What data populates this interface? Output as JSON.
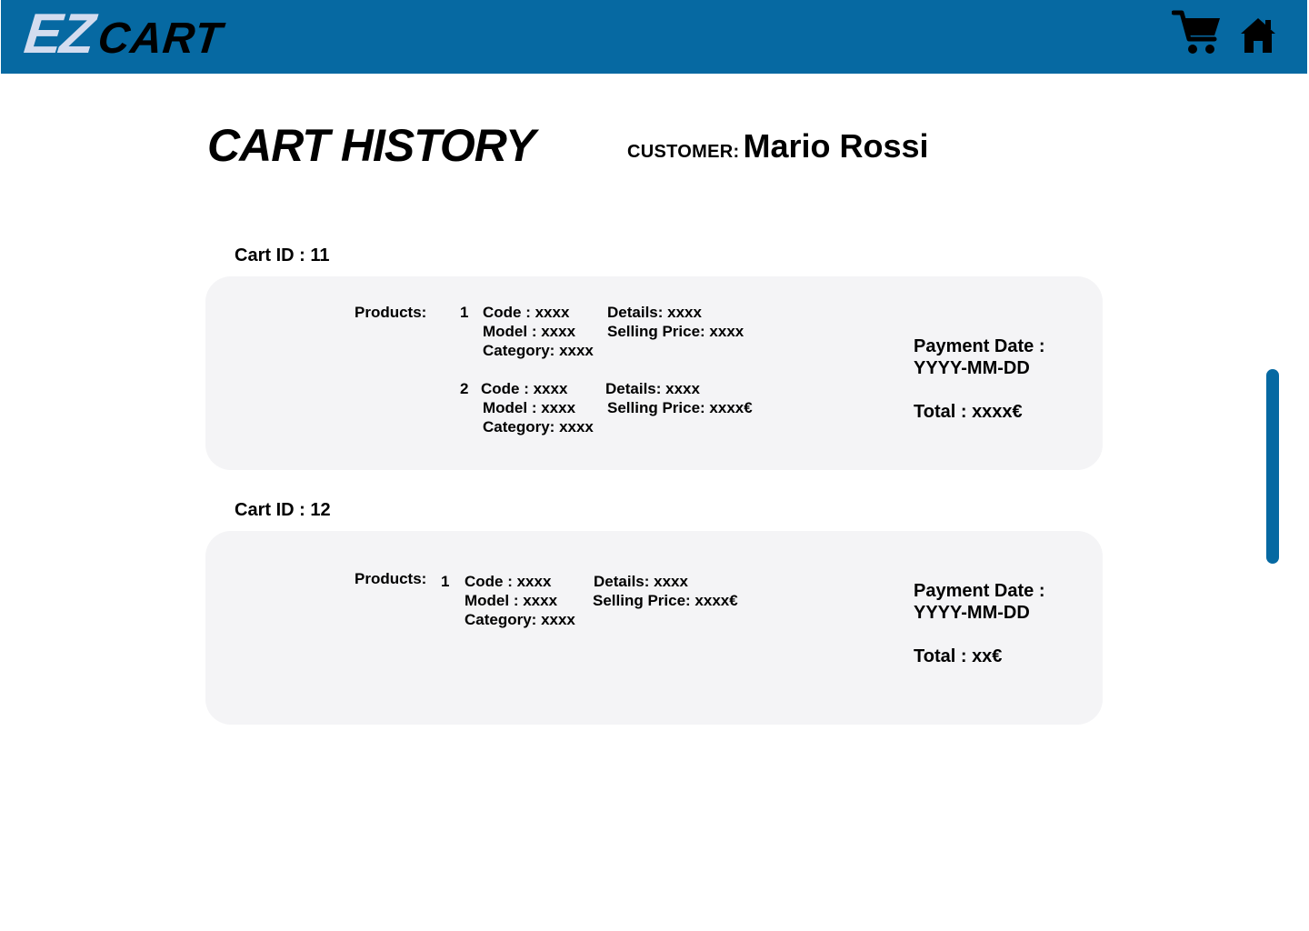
{
  "header": {
    "logo_ez": "EZ",
    "logo_cart": "CART",
    "cart_icon": "cart-icon",
    "home_icon": "home-icon"
  },
  "page": {
    "title": "CART HISTORY",
    "customer_label": "CUSTOMER:",
    "customer_name": "Mario Rossi"
  },
  "carts": [
    {
      "id_label": "Cart ID : 11",
      "products_label": "Products:",
      "products": [
        {
          "index": "1",
          "code": "Code : xxxx",
          "details": "Details: xxxx",
          "model": "Model : xxxx",
          "selling_price": "Selling Price: xxxx",
          "category": "Category: xxxx"
        },
        {
          "index": "2",
          "code": "Code : xxxx",
          "details": "Details: xxxx",
          "model": "Model : xxxx",
          "selling_price": "Selling Price: xxxx€",
          "category": "Category: xxxx"
        }
      ],
      "payment_date_label": "Payment Date :",
      "payment_date": "YYYY-MM-DD",
      "total": "Total : xxxx€"
    },
    {
      "id_label": "Cart ID : 12",
      "products_label": "Products:",
      "products": [
        {
          "index": "1",
          "code": "Code : xxxx",
          "details": "Details: xxxx",
          "model": "Model : xxxx",
          "selling_price": "Selling Price: xxxx€",
          "category": "Category: xxxx"
        }
      ],
      "payment_date_label": "Payment Date :",
      "payment_date": "YYYY-MM-DD",
      "total": "Total : xx€"
    }
  ],
  "colors": {
    "primary": "#0669a2",
    "logo_light": "#d3dcef",
    "card_bg": "#f4f4f6"
  }
}
